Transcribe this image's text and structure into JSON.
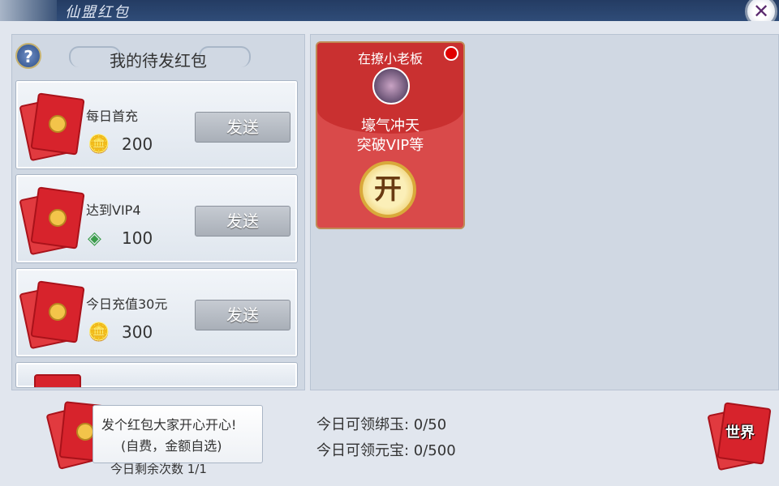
{
  "window": {
    "title": "仙盟红包"
  },
  "left_panel": {
    "title": "我的待发红包",
    "items": [
      {
        "label": "每日首充",
        "currency_icon": "gold-ingot-icon",
        "amount": "200",
        "button": "发送"
      },
      {
        "label": "达到VIP4",
        "currency_icon": "jade-icon",
        "amount": "100",
        "button": "发送"
      },
      {
        "label": "今日充值30元",
        "currency_icon": "gold-ingot-icon",
        "amount": "300",
        "button": "发送"
      }
    ],
    "promo": {
      "line1": "发个红包大家开心开心!",
      "line2": "(自费，金额自选)"
    },
    "remaining": "今日剩余次数 1/1"
  },
  "right_panel": {
    "card": {
      "sender": "在撩小老板",
      "message_l1": "壕气冲天",
      "message_l2": "突破VIP等",
      "open_label": "开"
    },
    "stats": {
      "jade": "今日可领绑玉: 0/50",
      "ingot": "今日可领元宝: 0/500"
    },
    "world_label": "世界"
  },
  "colors": {
    "envelope_red": "#d7232c",
    "gold": "#f3c44a",
    "accent": "#c08a55"
  }
}
